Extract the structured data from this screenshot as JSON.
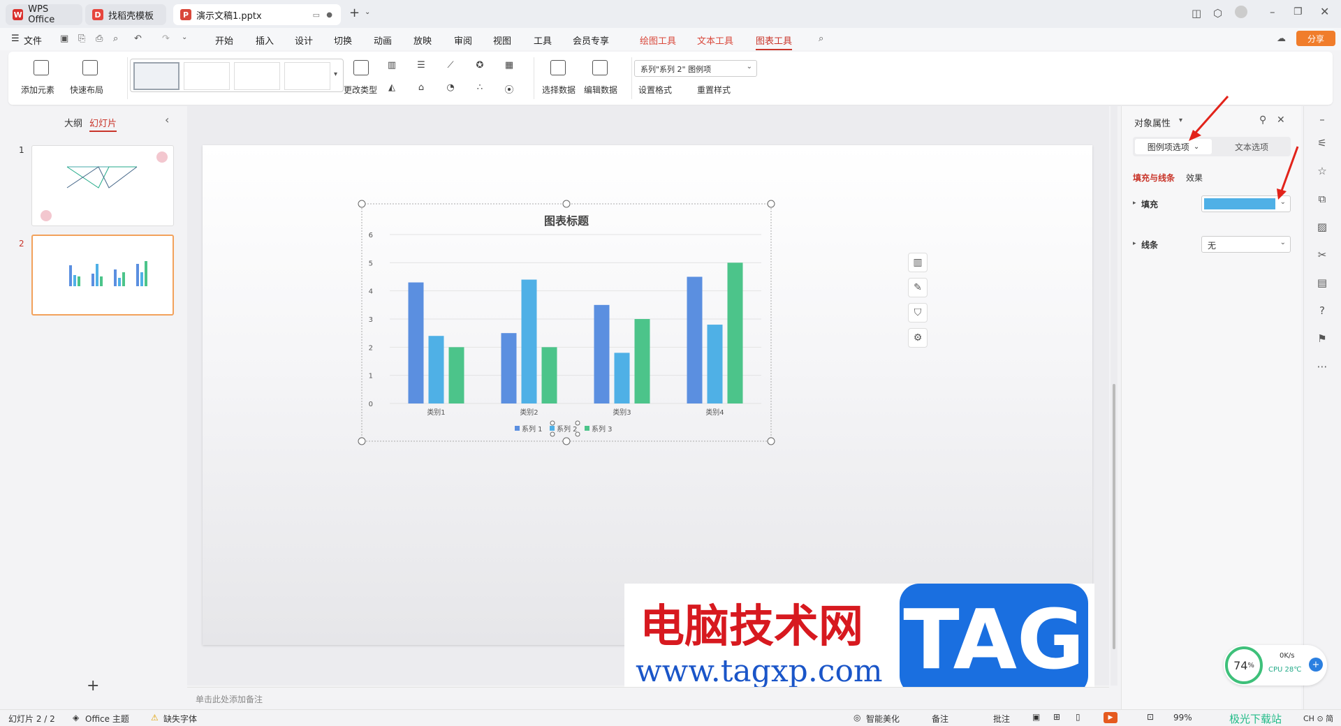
{
  "tabs": [
    {
      "label": "WPS Office"
    },
    {
      "label": "找稻壳模板"
    },
    {
      "label": "演示文稿1.pptx"
    }
  ],
  "menu": {
    "file": "文件",
    "items": [
      "开始",
      "插入",
      "设计",
      "切换",
      "动画",
      "放映",
      "审阅",
      "视图",
      "工具",
      "会员专享"
    ],
    "context": [
      "绘图工具",
      "文本工具",
      "图表工具"
    ],
    "share": "分享"
  },
  "ribbon": {
    "add_element": "添加元素",
    "quick_layout": "快速布局",
    "change_type": "更改类型",
    "select_data": "选择数据",
    "edit_data": "编辑数据",
    "series_select": "系列\"系列 2\" 图例项",
    "set_format": "设置格式",
    "reset_style": "重置样式"
  },
  "left": {
    "outline": "大纲",
    "slides": "幻灯片",
    "slide_numbers": [
      "1",
      "2"
    ],
    "add": "+"
  },
  "chart_data": {
    "type": "bar",
    "title": "图表标题",
    "categories": [
      "类别1",
      "类别2",
      "类别3",
      "类别4"
    ],
    "series": [
      {
        "name": "系列 1",
        "values": [
          4.3,
          2.5,
          3.5,
          4.5
        ],
        "color": "#5b8fe0"
      },
      {
        "name": "系列 2",
        "values": [
          2.4,
          4.4,
          1.8,
          2.8
        ],
        "color": "#4fb0e6"
      },
      {
        "name": "系列 3",
        "values": [
          2.0,
          2.0,
          3.0,
          5.0
        ],
        "color": "#4cc48a"
      }
    ],
    "ylim": [
      0,
      6
    ],
    "yticks": [
      "0",
      "1",
      "2",
      "3",
      "4",
      "5",
      "6"
    ],
    "legend": "bottom",
    "grid": true
  },
  "notes_placeholder": "单击此处添加备注",
  "panel": {
    "title": "对象属性",
    "tab_legend": "图例项选项",
    "tab_text": "文本选项",
    "sub_fill": "填充与线条",
    "sub_effect": "效果",
    "fill_label": "填充",
    "line_label": "线条",
    "line_value": "无",
    "fill_color": "#4fb0e6"
  },
  "status": {
    "slide_info": "幻灯片 2 / 2",
    "theme": "Office 主题",
    "missing_font": "缺失字体",
    "beautify": "智能美化",
    "notes": "备注",
    "comments": "批注",
    "zoom": "99%"
  },
  "watermark": {
    "text_cn": "电脑技术网",
    "url": "www.tagxp.com",
    "tag": "TAG"
  },
  "perf": {
    "percent": "74",
    "unit": "%",
    "speed": "0K/s",
    "cpu": "CPU 28℃"
  },
  "corner_logo": "极光下载站",
  "ime": "CH ⊙ 简"
}
